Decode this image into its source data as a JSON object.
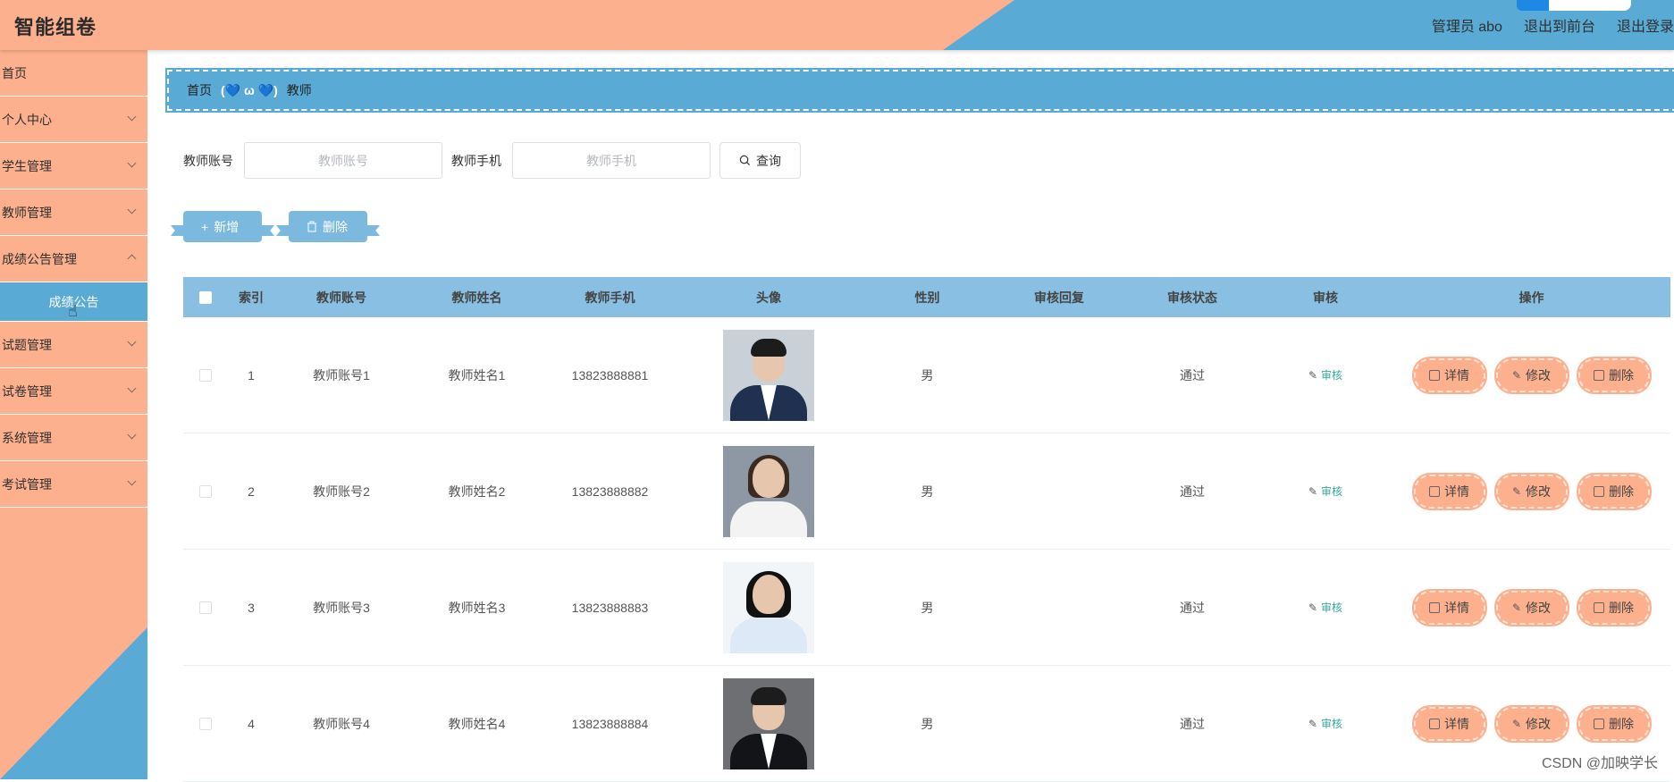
{
  "header": {
    "title": "智能组卷",
    "admin_label": "管理员 abo",
    "back_label": "退出到前台",
    "logout_label": "退出登录"
  },
  "sidebar": {
    "items": [
      {
        "label": "首页",
        "expandable": false
      },
      {
        "label": "个人中心",
        "expandable": true
      },
      {
        "label": "学生管理",
        "expandable": true
      },
      {
        "label": "教师管理",
        "expandable": true
      },
      {
        "label": "成绩公告管理",
        "expandable": true
      },
      {
        "label": "试题管理",
        "expandable": true
      },
      {
        "label": "试卷管理",
        "expandable": true
      },
      {
        "label": "系统管理",
        "expandable": true
      },
      {
        "label": "考试管理",
        "expandable": true
      }
    ],
    "active_sub": "成绩公告"
  },
  "breadcrumb": {
    "home": "首页",
    "separator": "(💙 ω 💙)",
    "current": "教师"
  },
  "search": {
    "account_label": "教师账号",
    "account_placeholder": "教师账号",
    "phone_label": "教师手机",
    "phone_placeholder": "教师手机",
    "query_label": "查询"
  },
  "actions": {
    "add_label": "新增",
    "delete_label": "删除"
  },
  "table": {
    "headers": [
      "索引",
      "教师账号",
      "教师姓名",
      "教师手机",
      "头像",
      "性别",
      "审核回复",
      "审核状态",
      "审核",
      "操作"
    ],
    "rows": [
      {
        "index": "1",
        "account": "教师账号1",
        "name": "教师姓名1",
        "phone": "13823888881",
        "sex": "男",
        "reply": "",
        "status": "通过",
        "audit": "审核",
        "avatar": "avatar-man-suit"
      },
      {
        "index": "2",
        "account": "教师账号2",
        "name": "教师姓名2",
        "phone": "13823888882",
        "sex": "男",
        "reply": "",
        "status": "通过",
        "audit": "审核",
        "avatar": "avatar-woman-white-shirt"
      },
      {
        "index": "3",
        "account": "教师账号3",
        "name": "教师姓名3",
        "phone": "13823888883",
        "sex": "男",
        "reply": "",
        "status": "通过",
        "audit": "审核",
        "avatar": "avatar-woman-blue-shirt"
      },
      {
        "index": "4",
        "account": "教师账号4",
        "name": "教师姓名4",
        "phone": "13823888884",
        "sex": "男",
        "reply": "",
        "status": "通过",
        "audit": "审核",
        "avatar": "avatar-man-dark-suit"
      }
    ],
    "ops": {
      "detail": "详情",
      "edit": "修改",
      "delete": "删除"
    }
  },
  "watermark": "CSDN @加映学长",
  "colors": {
    "peach": "#fdb08e",
    "blue": "#5aaad6",
    "table_header": "#88bfe2",
    "button_blue": "#7cb9df",
    "audit_link": "#35a89a"
  }
}
